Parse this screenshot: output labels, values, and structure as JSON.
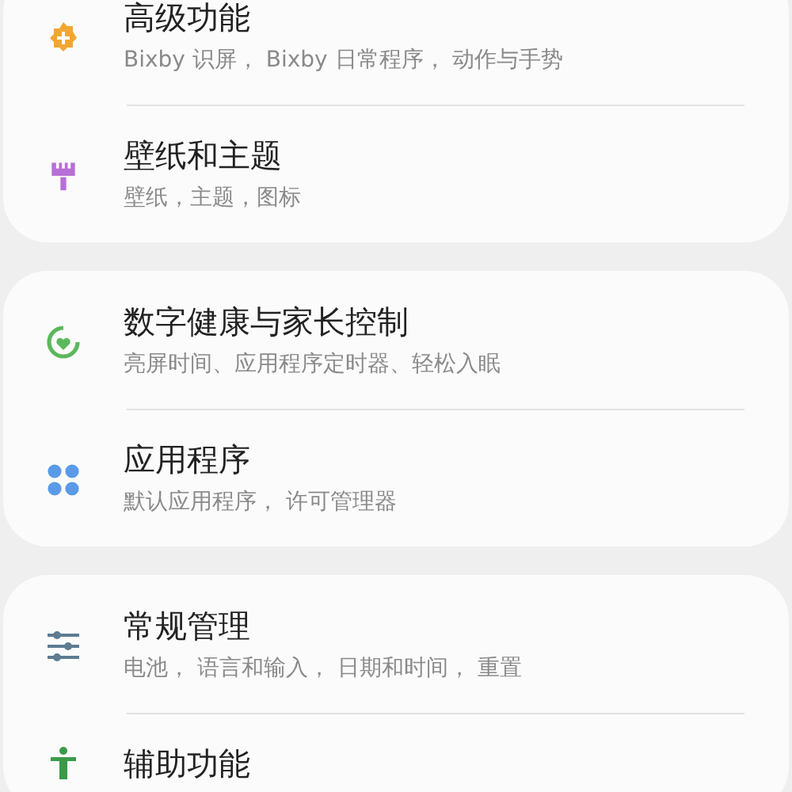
{
  "sections": [
    {
      "items": [
        {
          "kind": "advanced",
          "title": "高级功能",
          "subtitle": "Bixby 识屏， Bixby 日常程序， 动作与手势"
        },
        {
          "kind": "wallpaper",
          "title": "壁纸和主题",
          "subtitle": "壁纸，主题，图标"
        }
      ]
    },
    {
      "items": [
        {
          "kind": "wellbeing",
          "title": "数字健康与家长控制",
          "subtitle": "亮屏时间、应用程序定时器、轻松入眠"
        },
        {
          "kind": "apps",
          "title": "应用程序",
          "subtitle": "默认应用程序， 许可管理器"
        }
      ]
    },
    {
      "items": [
        {
          "kind": "general",
          "title": "常规管理",
          "subtitle": "电池， 语言和输入， 日期和时间， 重置"
        },
        {
          "kind": "accessibility",
          "title": "辅助功能"
        }
      ]
    }
  ]
}
